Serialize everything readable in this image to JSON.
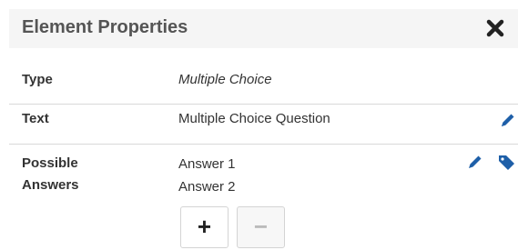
{
  "header": {
    "title": "Element Properties",
    "close_icon": "close-icon"
  },
  "properties": {
    "type": {
      "label": "Type",
      "value": "Multiple Choice"
    },
    "text": {
      "label": "Text",
      "value": "Multiple Choice Question",
      "edit_icon": "pencil-icon"
    },
    "answers": {
      "label": "Possible Answers",
      "items": [
        "Answer 1",
        "Answer 2"
      ],
      "edit_icon": "pencil-icon",
      "tag_icon": "tag-icon",
      "add_label": "+",
      "remove_label": "−"
    }
  },
  "colors": {
    "accent": "#1e5fa8",
    "header_bg": "#f5f5f5",
    "divider": "#d9d9d9"
  }
}
